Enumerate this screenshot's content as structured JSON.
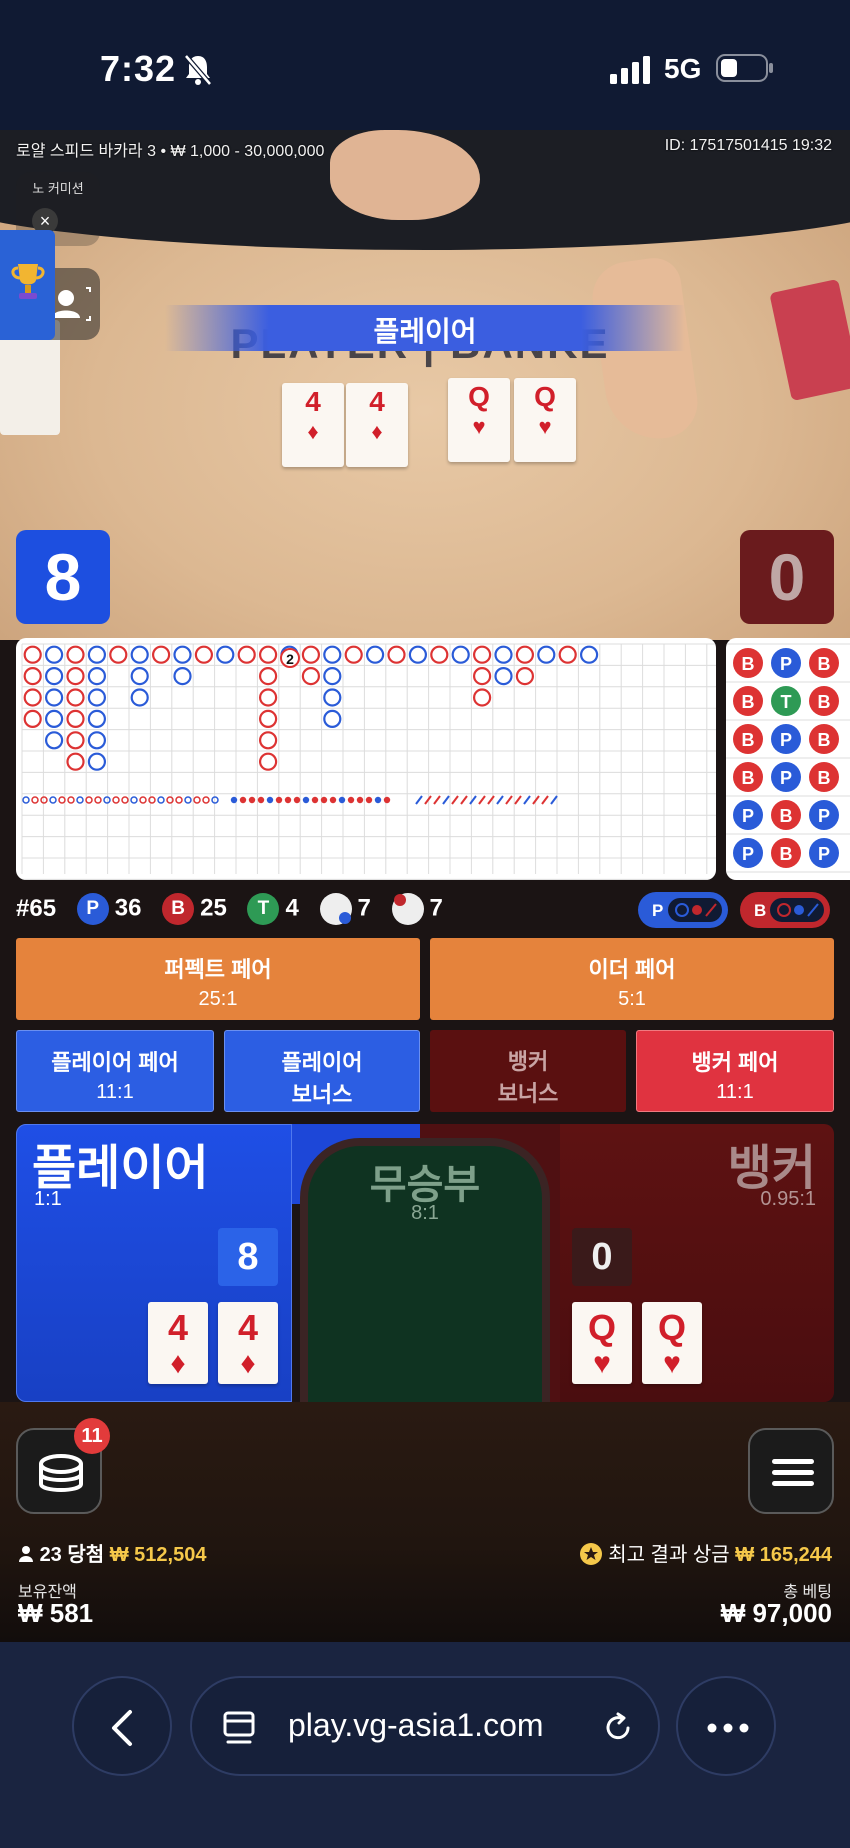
{
  "status_bar": {
    "time": "7:32",
    "network": "5G"
  },
  "video": {
    "game_info": "로얄 스피드 바카라 3 • ₩ 1,000 - 30,000,000",
    "game_id": "ID: 17517501415 19:32",
    "no_commission_label": "노 커미션",
    "banner": "플레이어",
    "felt_text": "PLAYER | BANKE",
    "player_cards": [
      {
        "rank": "4",
        "suit": "♦"
      },
      {
        "rank": "4",
        "suit": "♦"
      }
    ],
    "banker_cards": [
      {
        "rank": "Q",
        "suit": "♥"
      },
      {
        "rank": "Q",
        "suit": "♥"
      }
    ],
    "player_score": "8",
    "banker_score": "0"
  },
  "roadmap": {
    "big_road_marker": "2",
    "side_rows": [
      [
        "B",
        "P",
        "B"
      ],
      [
        "B",
        "T",
        "B"
      ],
      [
        "B",
        "P",
        "B"
      ],
      [
        "B",
        "P",
        "B"
      ],
      [
        "P",
        "B",
        "P"
      ],
      [
        "P",
        "B",
        "P"
      ]
    ]
  },
  "stats": {
    "round": "#65",
    "player_label": "P",
    "player_count": "36",
    "banker_label": "B",
    "banker_count": "25",
    "tie_label": "T",
    "tie_count": "4",
    "player_pair_count": "7",
    "banker_pair_count": "7",
    "ask_player": "P",
    "ask_banker": "B"
  },
  "bets": {
    "perfect_pair": {
      "label": "퍼펙트 페어",
      "odds": "25:1"
    },
    "either_pair": {
      "label": "이더 페어",
      "odds": "5:1"
    },
    "player_pair": {
      "label": "플레이어 페어",
      "odds": "11:1"
    },
    "player_bonus": {
      "label1": "플레이어",
      "label2": "보너스"
    },
    "banker_bonus": {
      "label1": "뱅커",
      "label2": "보너스"
    },
    "banker_pair": {
      "label": "뱅커 페어",
      "odds": "11:1"
    },
    "player": {
      "label": "플레이어",
      "odds": "1:1",
      "score": "8"
    },
    "tie": {
      "label": "무승부",
      "odds": "8:1"
    },
    "banker": {
      "label": "뱅커",
      "odds": "0.95:1",
      "score": "0"
    }
  },
  "footer": {
    "chips_badge": "11",
    "winners_count": "23",
    "winners_label": "당첨",
    "winners_amount": "₩ 512,504",
    "best_label": "최고 결과 상금",
    "best_amount": "₩ 165,244",
    "balance_label": "보유잔액",
    "balance_value": "₩ 581",
    "total_label": "총 베팅",
    "total_value": "₩ 97,000"
  },
  "browser": {
    "url": "play.vg-asia1.com"
  },
  "colors": {
    "player": "#1d4fe0",
    "banker": "#c0272d",
    "tie": "#2e9a55",
    "pair_bets": "#e5833c"
  }
}
